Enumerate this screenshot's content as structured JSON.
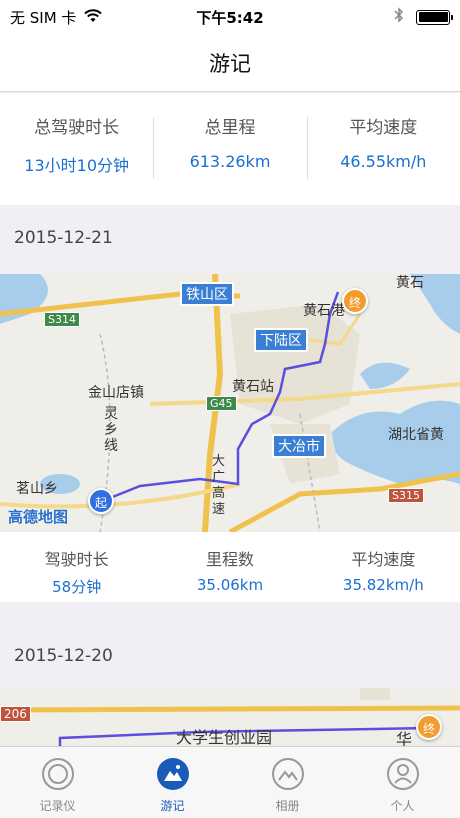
{
  "status_bar": {
    "carrier": "无 SIM 卡",
    "time": "下午5:42"
  },
  "nav": {
    "title": "游记"
  },
  "summary": [
    {
      "label": "总驾驶时长",
      "value": "13小时10分钟"
    },
    {
      "label": "总里程",
      "value": "613.26km"
    },
    {
      "label": "平均速度",
      "value": "46.55km/h"
    }
  ],
  "trips": [
    {
      "date": "2015-12-21",
      "map": {
        "places": {
          "tieshan": "铁山区",
          "xialu": "下陆区",
          "daye": "大冶市",
          "huangshi_station": "黄石站",
          "huangshi_port": "黄石港",
          "huangshi_top": "黄石",
          "jinshan": "金山店镇",
          "lingxiang": "灵乡线",
          "mingshan": "茗山乡",
          "hubei_museum": "湖北省黄",
          "daguang": "大广高速"
        },
        "roads": {
          "s314": "S314",
          "g45": "G45",
          "s315": "S315"
        },
        "start_marker": "起",
        "end_marker": "终",
        "logo": "高德地图"
      },
      "stats": [
        {
          "label": "驾驶时长",
          "value": "58分钟"
        },
        {
          "label": "里程数",
          "value": "35.06km"
        },
        {
          "label": "平均速度",
          "value": "35.82km/h"
        }
      ]
    },
    {
      "date": "2015-12-20",
      "map": {
        "places": {
          "park": "大学生创业园",
          "hua": "华"
        },
        "roads": {
          "r206": "206"
        },
        "end_marker": "终"
      }
    }
  ],
  "tabs": [
    {
      "label": "记录仪",
      "active": false,
      "icon": "recorder-icon"
    },
    {
      "label": "游记",
      "active": true,
      "icon": "travel-log-icon"
    },
    {
      "label": "相册",
      "active": false,
      "icon": "album-icon"
    },
    {
      "label": "个人",
      "active": false,
      "icon": "profile-icon"
    }
  ],
  "colors": {
    "accent": "#1a6fd0",
    "active_tab": "#1a5bb8",
    "route": "#5b4fe0",
    "start_marker": "#2f6fe0",
    "end_marker": "#f29b2e"
  }
}
